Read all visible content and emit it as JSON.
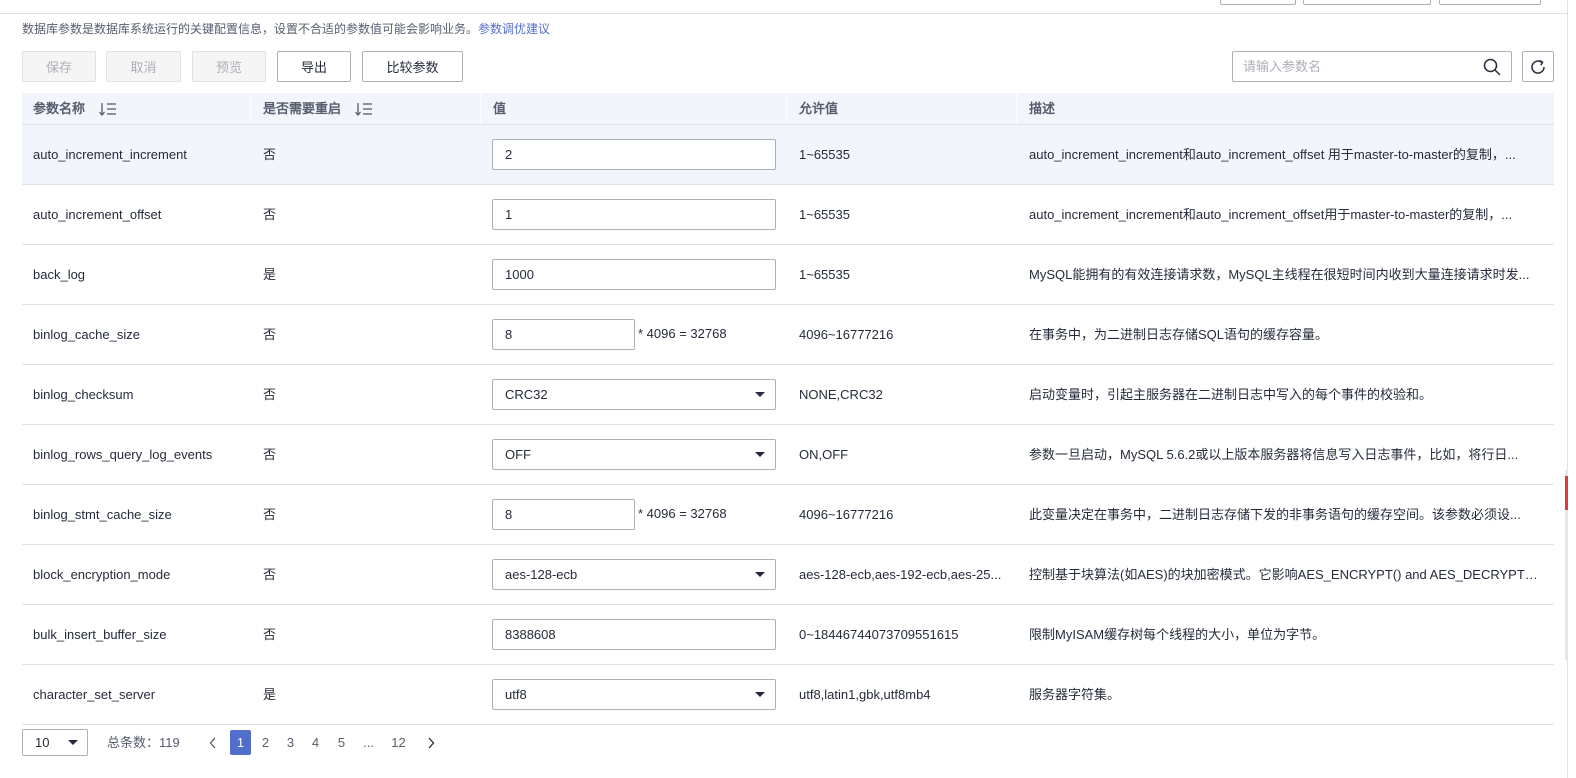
{
  "notice": {
    "text": "数据库参数是数据库系统运行的关键配置信息，设置不合适的参数值可能会影响业务。",
    "link": "参数调优建议"
  },
  "toolbar": {
    "save": "保存",
    "cancel": "取消",
    "preview": "预览",
    "export": "导出",
    "compare": "比较参数"
  },
  "search": {
    "placeholder": "请输入参数名"
  },
  "columns": {
    "name": "参数名称",
    "restart": "是否需要重启",
    "value": "值",
    "allowed": "允许值",
    "desc": "描述"
  },
  "rows": [
    {
      "name": "auto_increment_increment",
      "restart": "否",
      "value": "2",
      "type": "input",
      "allowed": "1~65535",
      "desc": "auto_increment_increment和auto_increment_offset 用于master-to-master的复制，..."
    },
    {
      "name": "auto_increment_offset",
      "restart": "否",
      "value": "1",
      "type": "input",
      "allowed": "1~65535",
      "desc": "auto_increment_increment和auto_increment_offset用于master-to-master的复制，..."
    },
    {
      "name": "back_log",
      "restart": "是",
      "value": "1000",
      "type": "input",
      "allowed": "1~65535",
      "desc": "MySQL能拥有的有效连接请求数，MySQL主线程在很短时间内收到大量连接请求时发..."
    },
    {
      "name": "binlog_cache_size",
      "restart": "否",
      "value": "8",
      "type": "multiplier",
      "suffix": "* 4096 = 32768",
      "allowed": "4096~16777216",
      "desc": "在事务中，为二进制日志存储SQL语句的缓存容量。"
    },
    {
      "name": "binlog_checksum",
      "restart": "否",
      "value": "CRC32",
      "type": "select",
      "allowed": "NONE,CRC32",
      "desc": "启动变量时，引起主服务器在二进制日志中写入的每个事件的校验和。"
    },
    {
      "name": "binlog_rows_query_log_events",
      "restart": "否",
      "value": "OFF",
      "type": "select",
      "allowed": "ON,OFF",
      "desc": "参数一旦启动，MySQL 5.6.2或以上版本服务器将信息写入日志事件，比如，将行日..."
    },
    {
      "name": "binlog_stmt_cache_size",
      "restart": "否",
      "value": "8",
      "type": "multiplier",
      "suffix": "* 4096 = 32768",
      "allowed": "4096~16777216",
      "desc": "此变量决定在事务中，二进制日志存储下发的非事务语句的缓存空间。该参数必须设..."
    },
    {
      "name": "block_encryption_mode",
      "restart": "否",
      "value": "aes-128-ecb",
      "type": "select",
      "allowed": "aes-128-ecb,aes-192-ecb,aes-25...",
      "desc": "控制基于块算法(如AES)的块加密模式。它影响AES_ENCRYPT() and AES_DECRYPT()..."
    },
    {
      "name": "bulk_insert_buffer_size",
      "restart": "否",
      "value": "8388608",
      "type": "input",
      "allowed": "0~18446744073709551615",
      "desc": "限制MyISAM缓存树每个线程的大小，单位为字节。"
    },
    {
      "name": "character_set_server",
      "restart": "是",
      "value": "utf8",
      "type": "select",
      "allowed": "utf8,latin1,gbk,utf8mb4",
      "desc": "服务器字符集。"
    }
  ],
  "pagination": {
    "page_size": "10",
    "total": "总条数：119",
    "pages": [
      "1",
      "2",
      "3",
      "4",
      "5",
      "...",
      "12"
    ],
    "current": "1"
  },
  "colors": {
    "accent": "#526ecc",
    "highlight_row": "#f2f5fc",
    "border": "#dfe1e6"
  },
  "icons": [
    "search-icon",
    "refresh-icon",
    "sort-icon",
    "chevron-down-icon",
    "chevron-left-icon",
    "chevron-right-icon"
  ]
}
